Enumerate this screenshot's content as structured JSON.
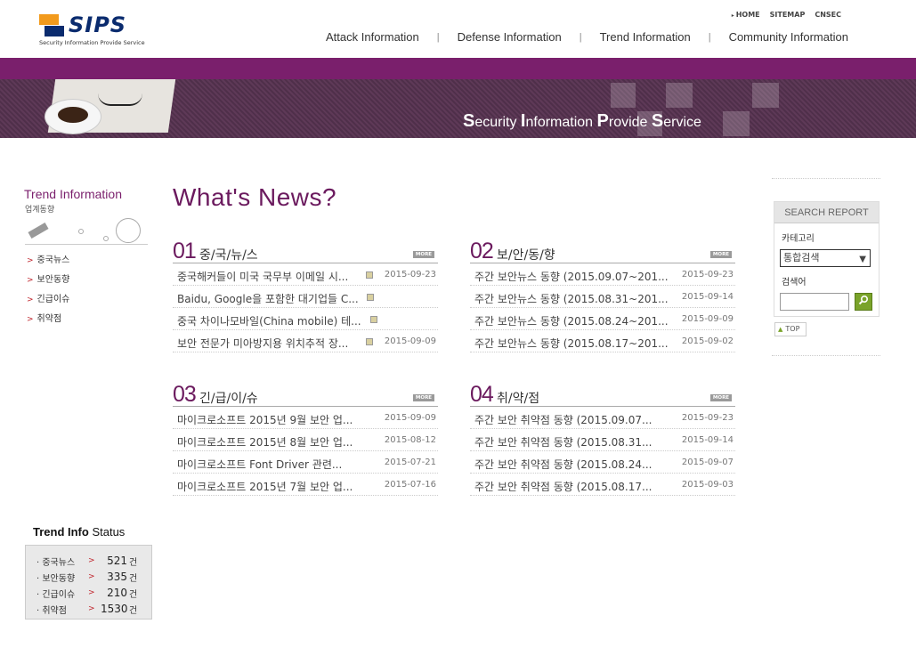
{
  "header": {
    "logo_text": "SIPS",
    "logo_subtitle": "Security Information Provide Service",
    "util_links": [
      "HOME",
      "SITEMAP",
      "CNSEC"
    ],
    "nav": [
      "Attack Information",
      "Defense Information",
      "Trend Information",
      "Community Information"
    ]
  },
  "banner": {
    "title_parts": [
      {
        "cap": "S",
        "rest": "ecurity "
      },
      {
        "cap": "I",
        "rest": "nformation "
      },
      {
        "cap": "P",
        "rest": "rovide "
      },
      {
        "cap": "S",
        "rest": "ervice"
      }
    ]
  },
  "sidebar": {
    "title": "Trend Information",
    "subtitle": "업계동향",
    "items": [
      "중국뉴스",
      "보안동향",
      "긴급이슈",
      "취약점"
    ]
  },
  "status": {
    "title_bold": "Trend Info",
    "title_rest": " Status",
    "unit": "건",
    "rows": [
      {
        "label": "· 중국뉴스",
        "count": "521"
      },
      {
        "label": "· 보안동향",
        "count": "335"
      },
      {
        "label": "· 긴급이슈",
        "count": "210"
      },
      {
        "label": "· 취약점",
        "count": "1530"
      }
    ]
  },
  "main": {
    "title": "What's News?",
    "more_label": "MORE",
    "sections": [
      {
        "num": "01",
        "category": "중/국/뉴/스",
        "items": [
          {
            "title": "중국해커들이 미국 국무부 이메일 시...",
            "date": "2015-09-23"
          },
          {
            "title": "Baidu, Google을 포함한 대기업들 C...",
            "date": ""
          },
          {
            "title": "중국 차이나모바일(China mobile) 테...",
            "date": ""
          },
          {
            "title": "보안 전문가 미아방지용 위치추적 장...",
            "date": "2015-09-09"
          }
        ]
      },
      {
        "num": "02",
        "category": "보/안/동/향",
        "items": [
          {
            "title": "주간 보안뉴스 동향 (2015.09.07~201...",
            "date": "2015-09-23"
          },
          {
            "title": "주간 보안뉴스 동향 (2015.08.31~201...",
            "date": "2015-09-14"
          },
          {
            "title": "주간 보안뉴스 동향 (2015.08.24~201...",
            "date": "2015-09-09"
          },
          {
            "title": "주간 보안뉴스 동향 (2015.08.17~201...",
            "date": "2015-09-02"
          }
        ]
      },
      {
        "num": "03",
        "category": "긴/급/이/슈",
        "items": [
          {
            "title": "마이크로소프트 2015년 9월 보안 업...",
            "date": "2015-09-09"
          },
          {
            "title": "마이크로소프트 2015년 8월 보안 업...",
            "date": "2015-08-12"
          },
          {
            "title": "마이크로소프트 Font Driver 관련...",
            "date": "2015-07-21"
          },
          {
            "title": "마이크로소프트 2015년 7월 보안 업...",
            "date": "2015-07-16"
          }
        ]
      },
      {
        "num": "04",
        "category": "취/약/점",
        "items": [
          {
            "title": "주간 보안 취약점 동향 (2015.09.07...",
            "date": "2015-09-23"
          },
          {
            "title": "주간 보안 취약점 동향 (2015.08.31...",
            "date": "2015-09-14"
          },
          {
            "title": "주간 보안 취약점 동향 (2015.08.24...",
            "date": "2015-09-07"
          },
          {
            "title": "주간 보안 취약점 동향 (2015.08.17...",
            "date": "2015-09-03"
          }
        ]
      }
    ]
  },
  "search": {
    "header": "SEARCH REPORT",
    "category_label": "카테고리",
    "category_value": "통합검색",
    "keyword_label": "검색어",
    "keyword_value": "",
    "top_label": "TOP"
  },
  "colors": {
    "accent": "#7a1f6c",
    "title": "#6b1a5e",
    "search_button": "#7aa32a",
    "arrow": "#c0252d"
  }
}
